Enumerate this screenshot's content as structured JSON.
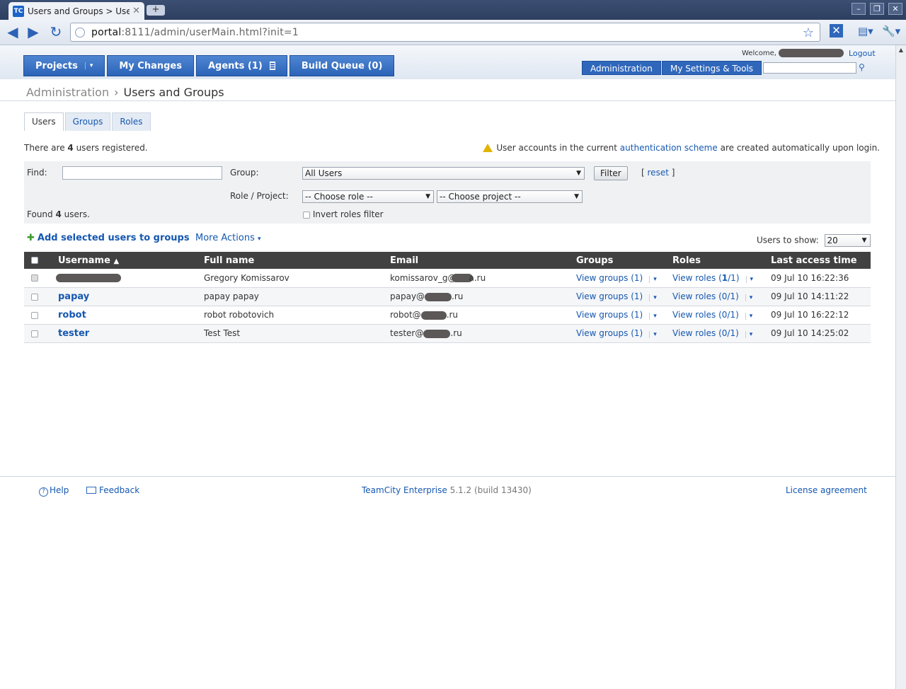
{
  "browser": {
    "tab_title": "Users and Groups > User...",
    "tab_icon_text": "TC",
    "url_host": "portal",
    "url_rest": ":8111/admin/userMain.html?init=1"
  },
  "header": {
    "nav": [
      {
        "label": "Projects"
      },
      {
        "label": "My Changes"
      },
      {
        "label": "Agents (1)"
      },
      {
        "label": "Build Queue (0)"
      }
    ],
    "welcome": "Welcome,",
    "logout": "Logout",
    "admin_button": "Administration",
    "settings_button": "My Settings & Tools",
    "search_value": ""
  },
  "breadcrumb": {
    "parent": "Administration",
    "current": "Users and Groups"
  },
  "tabs": [
    "Users",
    "Groups",
    "Roles"
  ],
  "info": {
    "left_pre": "There are ",
    "left_count": "4",
    "left_post": " users registered.",
    "right_pre": "User accounts in the current ",
    "right_link": "authentication scheme",
    "right_post": " are created automatically upon login."
  },
  "filter": {
    "find_label": "Find:",
    "find_value": "",
    "group_label": "Group:",
    "group_value": "All Users",
    "filter_button": "Filter",
    "reset_open": "[",
    "reset_link": "reset",
    "reset_close": "]",
    "role_label": "Role / Project:",
    "role_value": "-- Choose role --",
    "project_value": "-- Choose project --",
    "found_pre": "Found ",
    "found_count": "4",
    "found_post": " users.",
    "invert_label": "Invert roles filter"
  },
  "actions": {
    "add_label": "Add selected users to groups",
    "more_label": "More Actions",
    "users_to_show_label": "Users to show:",
    "users_to_show_value": "20"
  },
  "table": {
    "headers": [
      "Username",
      "Full name",
      "Email",
      "Groups",
      "Roles",
      "Last access time"
    ],
    "rows": [
      {
        "username": "",
        "fullname": "Gregory Komissarov",
        "email_pre": "komissarov_g@",
        "email_post": "a.ru",
        "groups": "View groups (1)",
        "roles_pre": "View roles (",
        "roles_bold": "1",
        "roles_post": "/1)",
        "last": "09 Jul 10 16:22:36"
      },
      {
        "username": "papay",
        "fullname": "papay papay",
        "email_pre": "papay@",
        "email_post": ".ru",
        "groups": "View groups (1)",
        "roles_pre": "View roles (",
        "roles_bold": "0",
        "roles_post": "/1)",
        "last": "09 Jul 10 14:11:22"
      },
      {
        "username": "robot",
        "fullname": "robot robotovich",
        "email_pre": "robot@",
        "email_post": ".ru",
        "groups": "View groups (1)",
        "roles_pre": "View roles (",
        "roles_bold": "0",
        "roles_post": "/1)",
        "last": "09 Jul 10 16:22:12"
      },
      {
        "username": "tester",
        "fullname": "Test Test",
        "email_pre": "tester@",
        "email_post": ".ru",
        "groups": "View groups (1)",
        "roles_pre": "View roles (",
        "roles_bold": "0",
        "roles_post": "/1)",
        "last": "09 Jul 10 14:25:02"
      }
    ]
  },
  "footer": {
    "help": "Help",
    "feedback": "Feedback",
    "product_link": "TeamCity Enterprise",
    "version": " 5.1.2 (build 13430)",
    "license": "License agreement"
  }
}
